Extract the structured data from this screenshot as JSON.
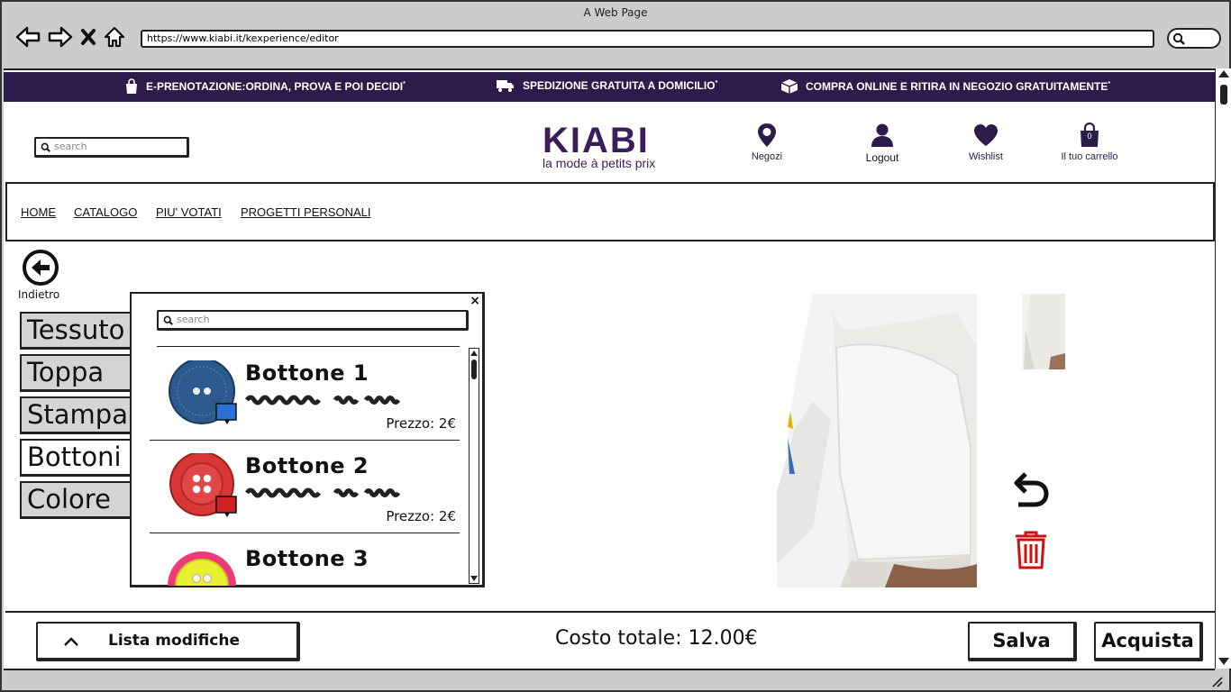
{
  "browser": {
    "title": "A Web Page",
    "url": "https://www.kiabi.it/kexperience/editor"
  },
  "promo": [
    {
      "icon": "shopping-bag-icon",
      "text": "E-PRENOTAZIONE:ORDINA, PROVA E POI DECIDI",
      "mark": "*"
    },
    {
      "icon": "truck-icon",
      "text": "SPEDIZIONE GRATUITA A DOMICILIO",
      "mark": "*"
    },
    {
      "icon": "package-icon",
      "text": "COMPRA ONLINE E RITIRA IN NEGOZIO GRATUITAMENTE",
      "mark": "*"
    }
  ],
  "header": {
    "search_placeholder": "search",
    "logo_word": "KIABI",
    "logo_tagline": "la mode à petits prix",
    "icons": [
      {
        "icon": "map-pin-icon",
        "label": "Negozi"
      },
      {
        "icon": "user-icon",
        "label": "Logout"
      },
      {
        "icon": "heart-icon",
        "label": "Wishlist"
      },
      {
        "icon": "cart-icon",
        "label": "Il tuo carrello",
        "count": "0"
      }
    ],
    "brand_color": "#2c1c4a"
  },
  "nav": [
    "HOME",
    "CATALOGO",
    "PIU' VOTATI",
    "PROGETTI PERSONALI"
  ],
  "editor": {
    "back_label": "Indietro",
    "tabs": [
      {
        "label": "Tessuto",
        "active": false
      },
      {
        "label": "Toppa",
        "active": false
      },
      {
        "label": "Stampa",
        "active": false
      },
      {
        "label": "Bottoni",
        "active": true
      },
      {
        "label": "Colore",
        "active": false
      }
    ],
    "popup": {
      "close": "×",
      "search_placeholder": "search",
      "items": [
        {
          "name": "Bottone 1",
          "price": "Prezzo: 2€",
          "color": "#2d5a8c",
          "badge_color": "#2a6fd6"
        },
        {
          "name": "Bottone 2",
          "price": "Prezzo: 2€",
          "color": "#d93636",
          "badge_color": "#cc2222"
        },
        {
          "name": "Bottone 3",
          "price": "",
          "color": "#e9f030",
          "badge_color": ""
        }
      ]
    },
    "tools": [
      {
        "icon": "undo-icon"
      },
      {
        "icon": "trash-icon",
        "color": "#cc1111"
      }
    ]
  },
  "footer": {
    "changes_label": "Lista modifiche",
    "total": "Costo totale: 12.00€",
    "save": "Salva",
    "buy": "Acquista"
  }
}
